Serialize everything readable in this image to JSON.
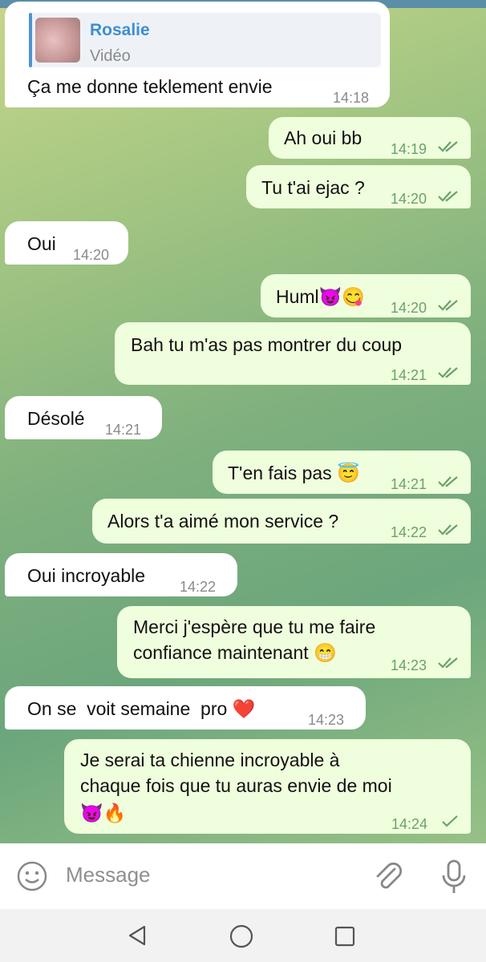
{
  "messages": [
    {
      "side": "in",
      "reply_name": "Rosalie",
      "reply_sub": "Vidéo",
      "text": "Ça me donne teklement envie",
      "time": "14:18"
    },
    {
      "side": "out",
      "text": "Ah oui bb",
      "time": "14:19"
    },
    {
      "side": "out",
      "text": "Tu t'ai ejac ?",
      "time": "14:20"
    },
    {
      "side": "in",
      "text": "Oui",
      "time": "14:20"
    },
    {
      "side": "out",
      "text": "Huml😈😋",
      "time": "14:20"
    },
    {
      "side": "out",
      "text": "Bah tu m'as pas montrer du coup",
      "time": "14:21"
    },
    {
      "side": "in",
      "text": "Désolé",
      "time": "14:21"
    },
    {
      "side": "out",
      "text": "T'en fais pas 😇",
      "time": "14:21"
    },
    {
      "side": "out",
      "text": "Alors t'a aimé mon service ?",
      "time": "14:22"
    },
    {
      "side": "in",
      "text": "Oui incroyable",
      "time": "14:22"
    },
    {
      "side": "out",
      "line1": "Merci j'espère que tu me faire",
      "line2": "confiance maintenant 😁",
      "time": "14:23"
    },
    {
      "side": "in",
      "text": "On se  voit semaine  pro ❤️",
      "time": "14:23"
    },
    {
      "side": "out",
      "line1": "Je serai ta chienne incroyable à",
      "line2": "chaque fois que tu auras envie de moi",
      "line3": "😈🔥",
      "time": "14:24"
    }
  ],
  "composer": {
    "placeholder": "Message"
  },
  "icons": {
    "emoji": "smiley-icon",
    "attach": "paperclip-icon",
    "mic": "microphone-icon",
    "back": "nav-back-icon",
    "home": "nav-home-icon",
    "recents": "nav-recents-icon"
  },
  "colors": {
    "incoming": "#ffffff",
    "outgoing": "#effedd",
    "accent": "#4e94d3",
    "read_tick": "#6aa26a"
  }
}
